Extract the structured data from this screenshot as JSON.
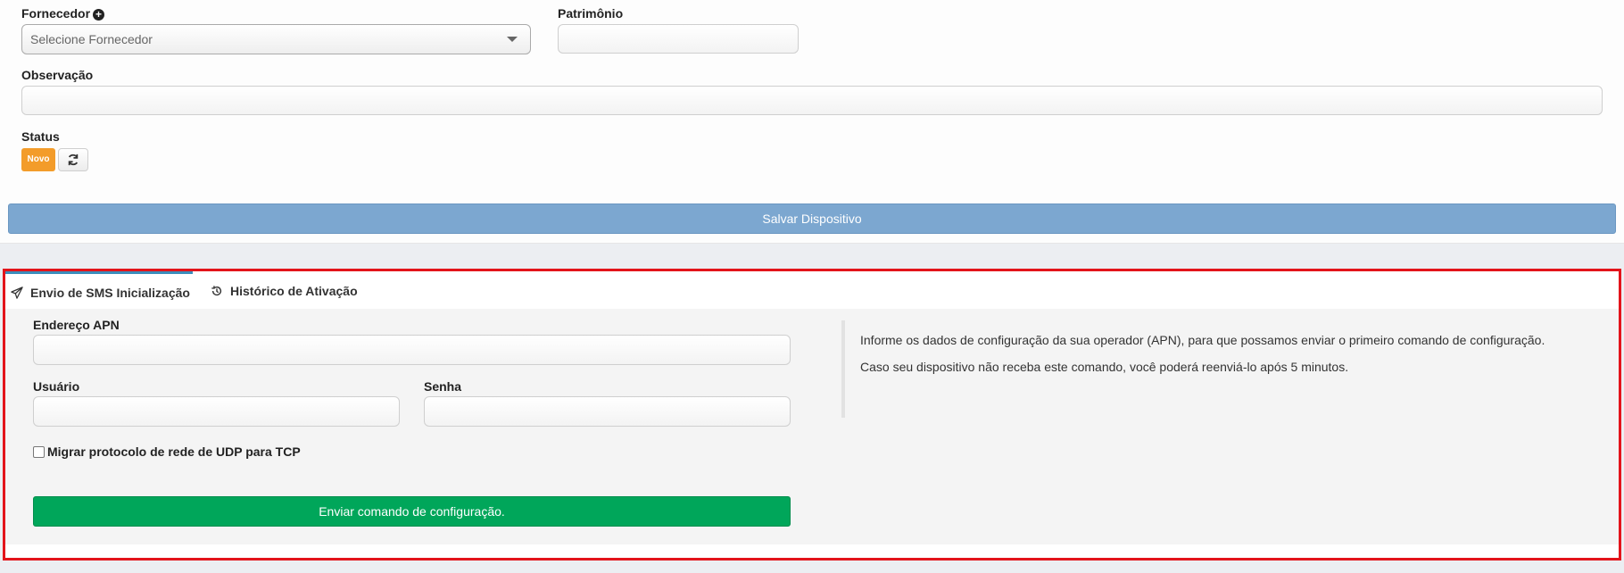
{
  "form": {
    "fornecedor_label": "Fornecedor",
    "fornecedor_placeholder": "Selecione Fornecedor",
    "patrimonio_label": "Patrimônio",
    "patrimonio_value": "",
    "observacao_label": "Observação",
    "observacao_value": "",
    "status_label": "Status",
    "status_badge": "Novo",
    "save_button": "Salvar Dispositivo"
  },
  "tabs": [
    {
      "label": "Envio de SMS Inicialização",
      "icon": "paper-plane-icon",
      "active": true
    },
    {
      "label": "Histórico de Ativação",
      "icon": "history-icon",
      "active": false
    }
  ],
  "sms": {
    "apn_label": "Endereço APN",
    "apn_value": "",
    "usuario_label": "Usuário",
    "usuario_value": "",
    "senha_label": "Senha",
    "senha_value": "",
    "checkbox_label": "Migrar protocolo de rede de UDP para TCP",
    "checkbox_checked": false,
    "send_button": "Enviar comando de configuração.",
    "info_1": "Informe os dados de configuração da sua operador (APN), para que possamos enviar o primeiro comando de configuração.",
    "info_2": "Caso seu dispositivo não receba este comando, você poderá reenviá-lo após 5 minutos."
  },
  "colors": {
    "accent": "#3c8dbc",
    "save_button": "#7ca7d0",
    "send_button": "#00a65a",
    "badge": "#f39c2a",
    "highlight_border": "#e3141b"
  }
}
